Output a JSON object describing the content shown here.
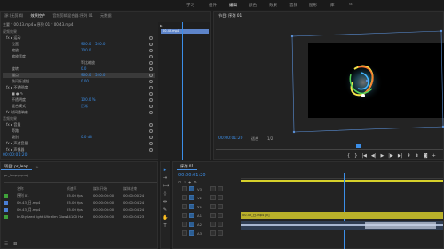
{
  "menubar": {
    "items": [
      {
        "label": "学习"
      },
      {
        "label": "组件"
      },
      {
        "label": "编辑",
        "active": true
      },
      {
        "label": "颜色"
      },
      {
        "label": "效果"
      },
      {
        "label": "音频"
      },
      {
        "label": "图形"
      },
      {
        "label": "库"
      },
      {
        "label": "≫"
      }
    ]
  },
  "effect_controls": {
    "tabs": [
      "源:(无剪辑)",
      "效果控件",
      "音频剪辑混合器:序列 01",
      "元数据"
    ],
    "clip_header": "主要 * 00.43.mp4 ▸ 序列 01 * 00.43.mp4",
    "mini_clip": "00.43.mp4",
    "rows": [
      {
        "label": "视频效果",
        "type": "section"
      },
      {
        "label": "fx ▸ 运动",
        "type": "group"
      },
      {
        "label": "位置",
        "v1": "960.0",
        "v2": "540.0"
      },
      {
        "label": "缩放",
        "v1": "100.0",
        "v2": ""
      },
      {
        "label": "缩放宽度",
        "v1": "",
        "v2": ""
      },
      {
        "label": "",
        "checkbox": "等比缩放"
      },
      {
        "label": "旋转",
        "v1": "0.0",
        "v2": ""
      },
      {
        "label": "锚点",
        "v1": "960.0",
        "v2": "540.0",
        "highlight": true
      },
      {
        "label": "防闪烁滤镜",
        "v1": "0.00",
        "v2": ""
      },
      {
        "label": "fx ▸ 不透明度",
        "type": "group"
      },
      {
        "label": "■ ● ✎",
        "v1": "",
        "v2": ""
      },
      {
        "label": "不透明度",
        "v1": "100.0 %",
        "v2": ""
      },
      {
        "label": "混合模式",
        "v1": "正常",
        "v2": ""
      },
      {
        "label": "fx 时间重映射",
        "type": "group"
      },
      {
        "label": "音频效果",
        "type": "section"
      },
      {
        "label": "fx ▸ 音量",
        "type": "group"
      },
      {
        "label": "旁路",
        "v1": "",
        "v2": ""
      },
      {
        "label": "级别",
        "v1": "0.0 dB",
        "v2": ""
      },
      {
        "label": "fx ▸ 声道音量",
        "type": "group"
      },
      {
        "label": "fx ▸ 声像器",
        "type": "group"
      }
    ],
    "timecode": "00:00:01:20"
  },
  "program_monitor": {
    "title": "节目: 序列 01",
    "timecode": "00:00:01:20",
    "zoom": "适合",
    "quality": "1/2"
  },
  "project_panel": {
    "tabs": [
      "项目: pr_leap",
      "≫"
    ],
    "project_file": "pr_leap.prproj",
    "columns": [
      "名称",
      "帧速率",
      "媒体开始",
      "媒体结束"
    ],
    "files": [
      {
        "name": "序列 01",
        "fps": "25.00 fps",
        "start": "00:00:00:00",
        "end": "00:00:00:24",
        "color": "#3fa13a"
      },
      {
        "name": "00.43_日.mp4",
        "fps": "25.00 fps",
        "start": "00:00:00:00",
        "end": "00:00:04:24",
        "color": "#4a7fd6"
      },
      {
        "name": "00.43_月.mp4",
        "fps": "25.00 fps",
        "start": "00:00:00:00",
        "end": "00:00:04:24",
        "color": "#4a7fd6"
      },
      {
        "name": "In-Stylized light Ultralim Glow",
        "fps": "44100 Hz",
        "start": "00:00:00:00",
        "end": "00:00:04:23",
        "color": "#3fa13a"
      }
    ]
  },
  "timeline": {
    "tab": "序列 01",
    "timecode": "00:00:01:20",
    "tracks": [
      {
        "name": "V3"
      },
      {
        "name": "V2"
      },
      {
        "name": "V1"
      },
      {
        "name": "A1"
      },
      {
        "name": "A2"
      },
      {
        "name": "A3"
      }
    ],
    "clip_video": "00.43_日.mp4 [V]",
    "clip_audio": ""
  },
  "colors": {
    "accent": "#3b8ee8",
    "panel": "#232323",
    "bg": "#1d1d1d"
  }
}
